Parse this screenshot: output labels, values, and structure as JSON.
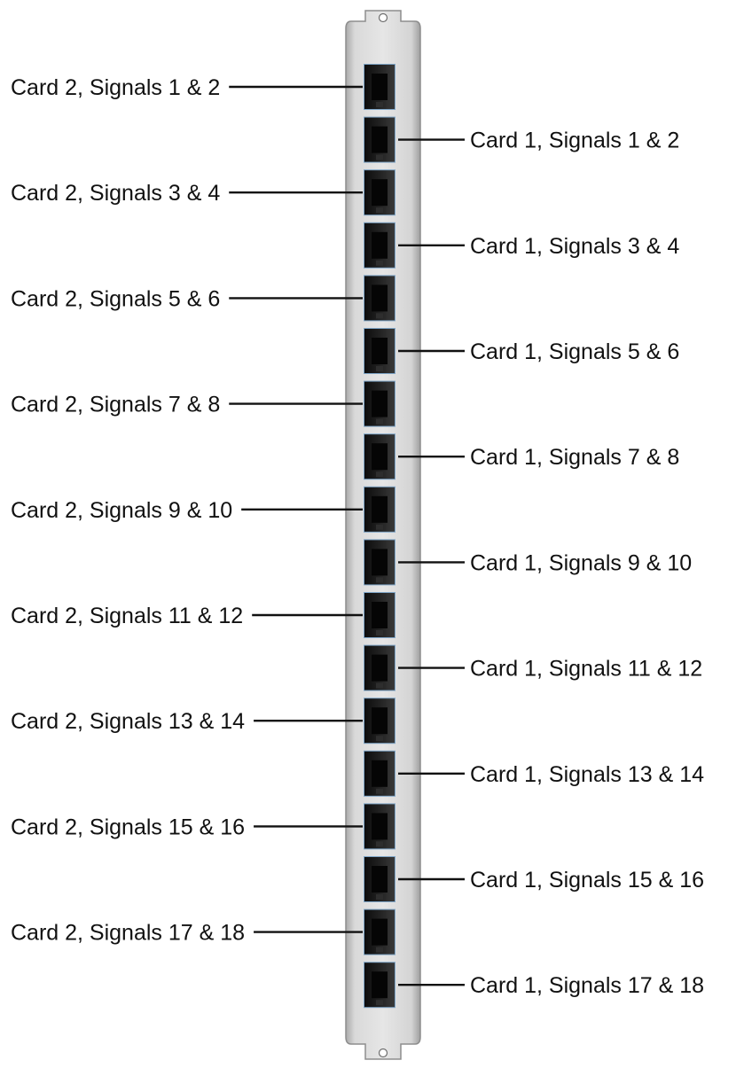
{
  "ports": [
    {
      "label": "Card 2, Signals 1 & 2",
      "side": "left"
    },
    {
      "label": "Card 1, Signals 1 & 2",
      "side": "right"
    },
    {
      "label": "Card 2, Signals 3 & 4",
      "side": "left"
    },
    {
      "label": "Card 1, Signals 3 & 4",
      "side": "right"
    },
    {
      "label": "Card 2, Signals 5 & 6",
      "side": "left"
    },
    {
      "label": "Card 1, Signals 5 & 6",
      "side": "right"
    },
    {
      "label": "Card 2, Signals 7 & 8",
      "side": "left"
    },
    {
      "label": "Card 1, Signals 7 & 8",
      "side": "right"
    },
    {
      "label": "Card 2, Signals 9 & 10",
      "side": "left"
    },
    {
      "label": "Card 1, Signals 9 & 10",
      "side": "right"
    },
    {
      "label": "Card 2, Signals 11 & 12",
      "side": "left"
    },
    {
      "label": "Card 1, Signals 11 & 12",
      "side": "right"
    },
    {
      "label": "Card 2, Signals 13 & 14",
      "side": "left"
    },
    {
      "label": "Card 1, Signals 13 & 14",
      "side": "right"
    },
    {
      "label": "Card 2, Signals 15 & 16",
      "side": "left"
    },
    {
      "label": "Card 1, Signals 15 & 16",
      "side": "right"
    },
    {
      "label": "Card 2, Signals 17 & 18",
      "side": "left"
    },
    {
      "label": "Card 1, Signals 17 & 18",
      "side": "right"
    }
  ],
  "colors": {
    "bracket": "#cfcfcf",
    "bracket_edge": "#8d8d8d",
    "port_body": "#1a1a1a",
    "port_rim": "#7fa6c8",
    "leader": "#111111",
    "text": "#111111"
  }
}
